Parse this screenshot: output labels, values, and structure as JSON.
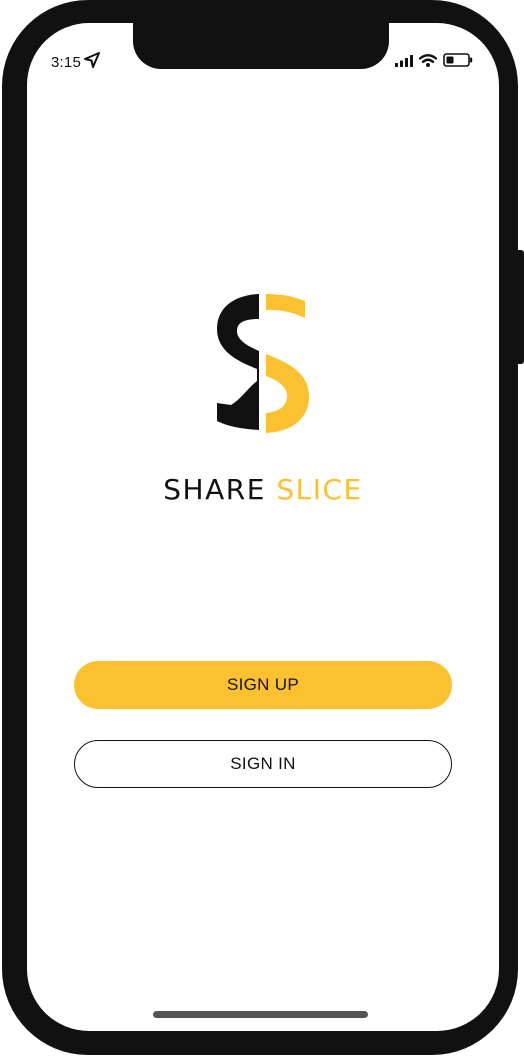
{
  "status_bar": {
    "time": "3:15",
    "location_icon": "location-arrow-icon",
    "signal_icon": "cellular-signal-icon",
    "wifi_icon": "wifi-icon",
    "battery_icon": "battery-icon",
    "battery_level": 0.35
  },
  "brand": {
    "logo_icon": "share-slice-logo",
    "name_part1": "SHARE",
    "name_part2": "SLICE"
  },
  "actions": {
    "sign_up_label": "SIGN UP",
    "sign_in_label": "SIGN IN"
  },
  "colors": {
    "accent": "#fcc130",
    "dark": "#111111",
    "background": "#ffffff"
  }
}
